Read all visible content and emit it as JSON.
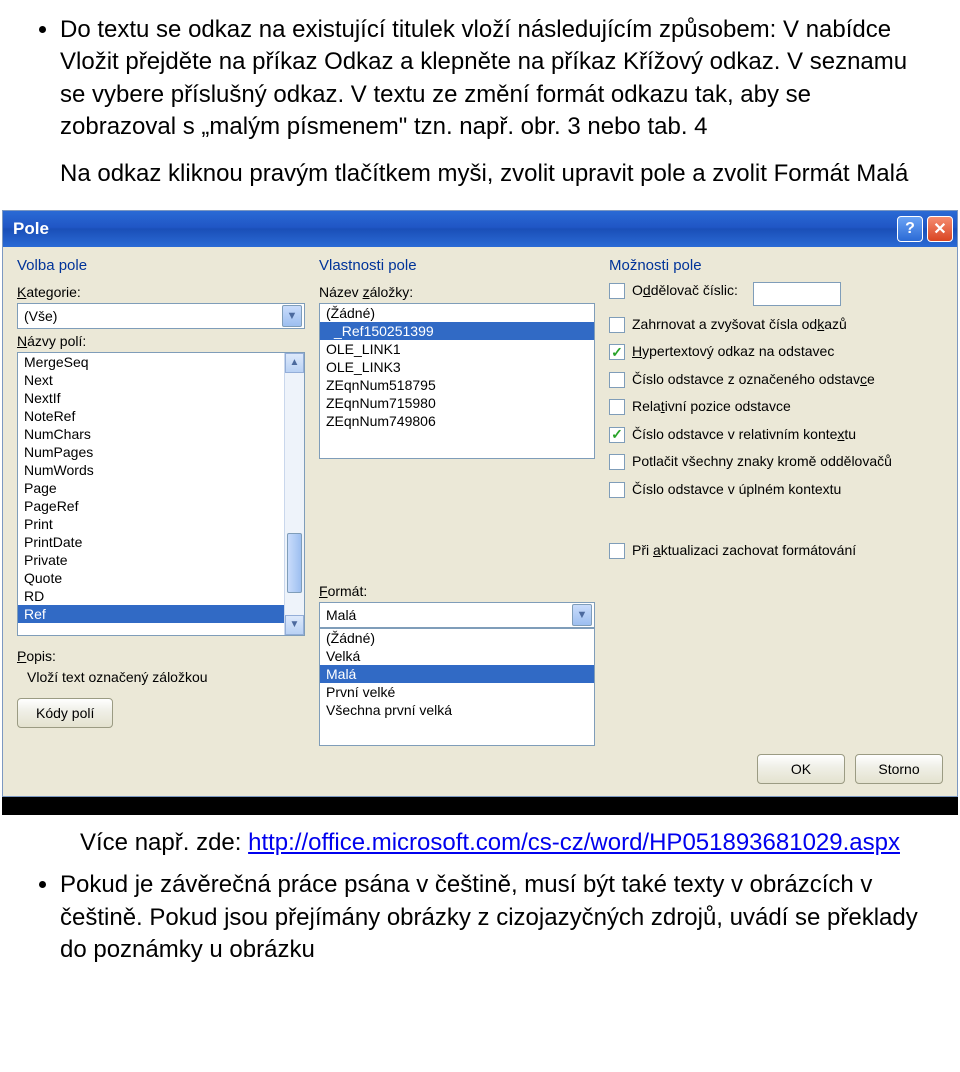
{
  "doc": {
    "bullet1": "Do textu se odkaz na existující titulek vloží následujícím způsobem: V nabídce Vložit přejděte na příkaz Odkaz a klepněte na příkaz Křížový odkaz. V seznamu se vybere příslušný odkaz. V textu ze změní formát odkazu tak, aby se zobrazoval s „malým písmenem\" tzn. např. obr. 3 nebo tab. 4",
    "para2": "Na odkaz kliknou pravým tlačítkem myši, zvolit upravit pole a zvolit Formát Malá",
    "more_label": "Více např. zde: ",
    "more_link": "http://office.microsoft.com/cs-cz/word/HP051893681029.aspx",
    "bullet2": "Pokud je závěrečná práce psána v češtině, musí být také texty v obrázcích v češtině. Pokud jsou přejímány obrázky z cizojazyčných zdrojů, uvádí se překlady do poznámky u obrázku"
  },
  "dialog": {
    "title": "Pole",
    "left": {
      "heading": "Volba pole",
      "category_label": "Kategorie:",
      "category_value": "(Vše)",
      "field_names_label": "Názvy polí:",
      "fields": [
        "MergeSeq",
        "Next",
        "NextIf",
        "NoteRef",
        "NumChars",
        "NumPages",
        "NumWords",
        "Page",
        "PageRef",
        "Print",
        "PrintDate",
        "Private",
        "Quote",
        "RD",
        "Ref"
      ],
      "fields_sel": "Ref",
      "desc_label": "Popis:",
      "desc_text": "Vloží text označený záložkou",
      "codes_btn": "Kódy polí"
    },
    "mid": {
      "heading": "Vlastnosti pole",
      "bookmark_label": "Název záložky:",
      "bookmarks": [
        "(Žádné)",
        "_Ref150251399",
        "OLE_LINK1",
        "OLE_LINK3",
        "ZEqnNum518795",
        "ZEqnNum715980",
        "ZEqnNum749806"
      ],
      "bookmark_sel": "_Ref150251399",
      "format_label": "Formát:",
      "format_combo": "Malá",
      "formats": [
        "(Žádné)",
        "Velká",
        "Malá",
        "První velké",
        "Všechna první velká"
      ],
      "format_sel": "Malá"
    },
    "right": {
      "heading": "Možnosti pole",
      "opt1": "Oddělovač číslic:",
      "opt2": "Zahrnovat a zvyšovat čísla odkazů",
      "opt3": "Hypertextový odkaz na odstavec",
      "opt4": "Číslo odstavce z označeného odstavce",
      "opt5": "Relativní pozice odstavce",
      "opt6": "Číslo odstavce v relativním kontextu",
      "opt7": "Potlačit všechny znaky kromě oddělovačů",
      "opt8": "Číslo odstavce v úplném kontextu",
      "opt9": "Při aktualizaci zachovat formátování"
    },
    "footer": {
      "ok": "OK",
      "cancel": "Storno"
    }
  }
}
